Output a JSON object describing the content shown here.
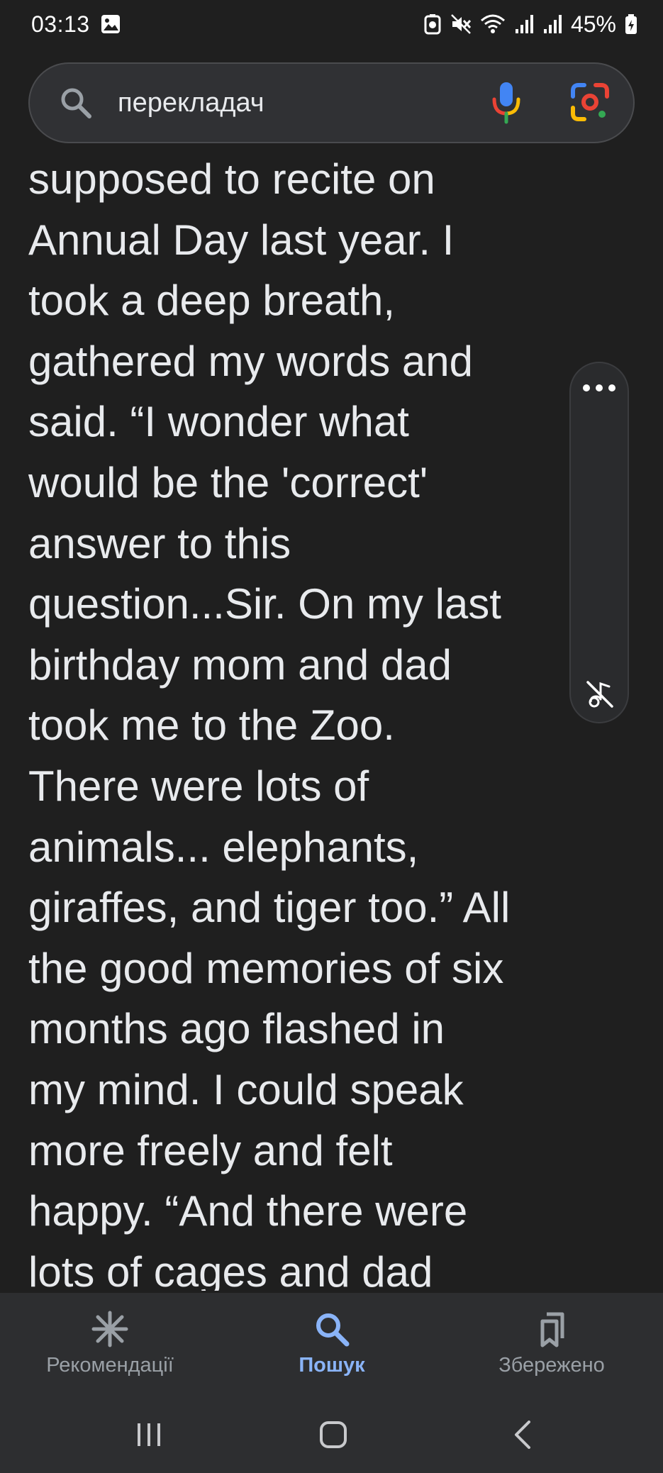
{
  "status_bar": {
    "time": "03:13",
    "battery": "45%",
    "icons": [
      "gallery-icon",
      "battery-saver-icon",
      "mute-icon",
      "wifi-icon",
      "signal-icon",
      "signal-icon",
      "battery-icon"
    ]
  },
  "search": {
    "query": "перекладач",
    "icons": [
      "search-icon",
      "mic-icon",
      "lens-icon"
    ]
  },
  "article": {
    "lines": [
      "supposed to recite on",
      "Annual Day last year. I",
      "took a deep breath,",
      "gathered my words and",
      "said. “I wonder what",
      "would be the 'correct'",
      "answer to this",
      "question...Sir. On my last",
      "birthday mom and dad",
      "took me to the Zoo.",
      "There were lots of",
      "animals... elephants,",
      "giraffes, and tiger too.” All",
      "the good memories of six",
      "months ago flashed in",
      "my mind. I could speak",
      "more freely and felt",
      "happy. “And there were",
      "lots of cages and dad"
    ]
  },
  "side_panel": {
    "icons": [
      "more-icon",
      "audio-off-icon"
    ]
  },
  "bottom_nav": {
    "items": [
      {
        "label": "Рекомендації",
        "icon": "asterisk-icon",
        "active": false
      },
      {
        "label": "Пошук",
        "icon": "search-icon",
        "active": true
      },
      {
        "label": "Збережено",
        "icon": "bookmarks-icon",
        "active": false
      }
    ]
  },
  "system_nav": {
    "icons": [
      "recents-icon",
      "home-icon",
      "back-icon"
    ]
  },
  "colors": {
    "background": "#1f1f1f",
    "search_bar": "#303134",
    "nav_bar": "#2d2e30",
    "text": "#e8eaed",
    "accent": "#8ab4f8",
    "inactive": "#9aa0a6"
  }
}
